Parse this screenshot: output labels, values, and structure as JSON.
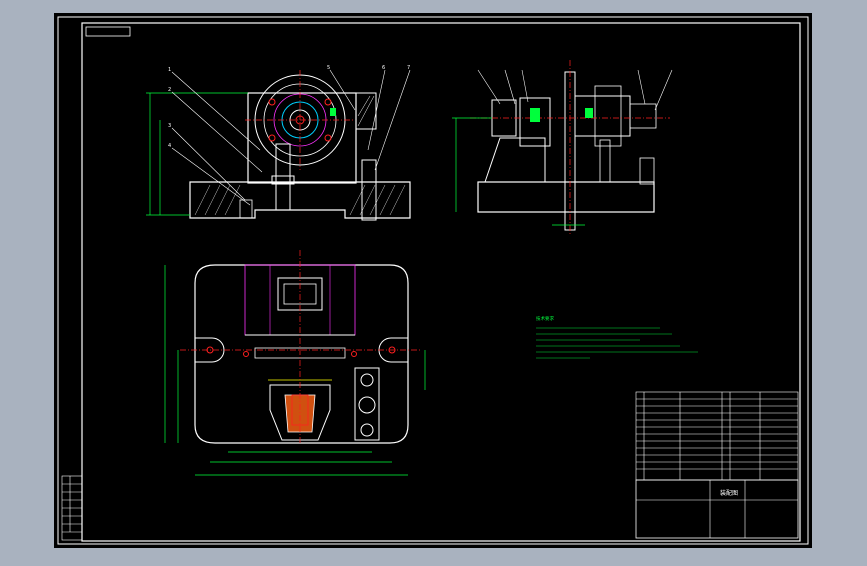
{
  "colors": {
    "frame_bg": "#a9b2bf",
    "sheet": "#000000",
    "line_white": "#ffffff",
    "line_green": "#00ff3c",
    "line_magenta": "#ff33ff",
    "line_red": "#ff2020",
    "line_yellow": "#ffff00",
    "line_cyan": "#00d0ff",
    "hatch": "#ffffff"
  },
  "title_block": {
    "drawing_title": "装配图"
  },
  "notes": {
    "heading": "技术要求"
  }
}
